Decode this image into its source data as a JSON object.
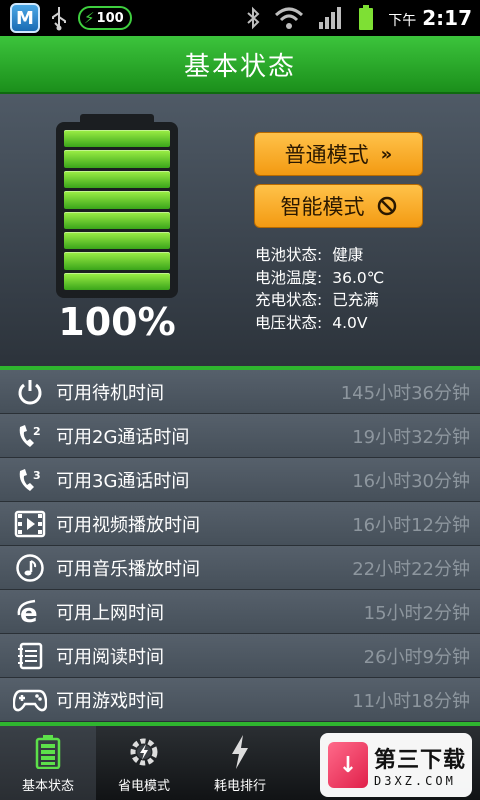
{
  "statusbar": {
    "app_badge": "M",
    "battery_pill": "100",
    "time_ampm": "下午",
    "time": "2:17"
  },
  "header": {
    "title": "基本状态"
  },
  "battery": {
    "percent_label": "100%",
    "level": 1.0
  },
  "modes": {
    "normal_label": "普通模式",
    "normal_icon": "double-chevron-right",
    "smart_label": "智能模式",
    "smart_icon": "no-entry"
  },
  "info": [
    {
      "label": "电池状态:",
      "value": "健康"
    },
    {
      "label": "电池温度:",
      "value": "36.0℃"
    },
    {
      "label": "充电状态:",
      "value": "已充满"
    },
    {
      "label": "电压状态:",
      "value": "4.0V"
    }
  ],
  "usage": [
    {
      "icon": "power-icon",
      "label": "可用待机时间",
      "value": "145小时36分钟"
    },
    {
      "icon": "call-2g-icon",
      "label": "可用2G通话时间",
      "value": "19小时32分钟"
    },
    {
      "icon": "call-3g-icon",
      "label": "可用3G通话时间",
      "value": "16小时30分钟"
    },
    {
      "icon": "video-icon",
      "label": "可用视频播放时间",
      "value": "16小时12分钟"
    },
    {
      "icon": "music-icon",
      "label": "可用音乐播放时间",
      "value": "22小时22分钟"
    },
    {
      "icon": "browser-icon",
      "label": "可用上网时间",
      "value": "15小时2分钟"
    },
    {
      "icon": "book-icon",
      "label": "可用阅读时间",
      "value": "26小时9分钟"
    },
    {
      "icon": "gamepad-icon",
      "label": "可用游戏时间",
      "value": "11小时18分钟"
    }
  ],
  "nav": [
    {
      "label": "基本状态",
      "active": true
    },
    {
      "label": "省电模式"
    },
    {
      "label": "耗电排行"
    }
  ],
  "watermark": {
    "logo_glyph": "↓",
    "title": "第三下载",
    "domain": "D3XZ.COM"
  },
  "colors": {
    "header_green": "#2fb52f",
    "button_orange": "#f7a823",
    "battery_green": "#7ee034"
  }
}
